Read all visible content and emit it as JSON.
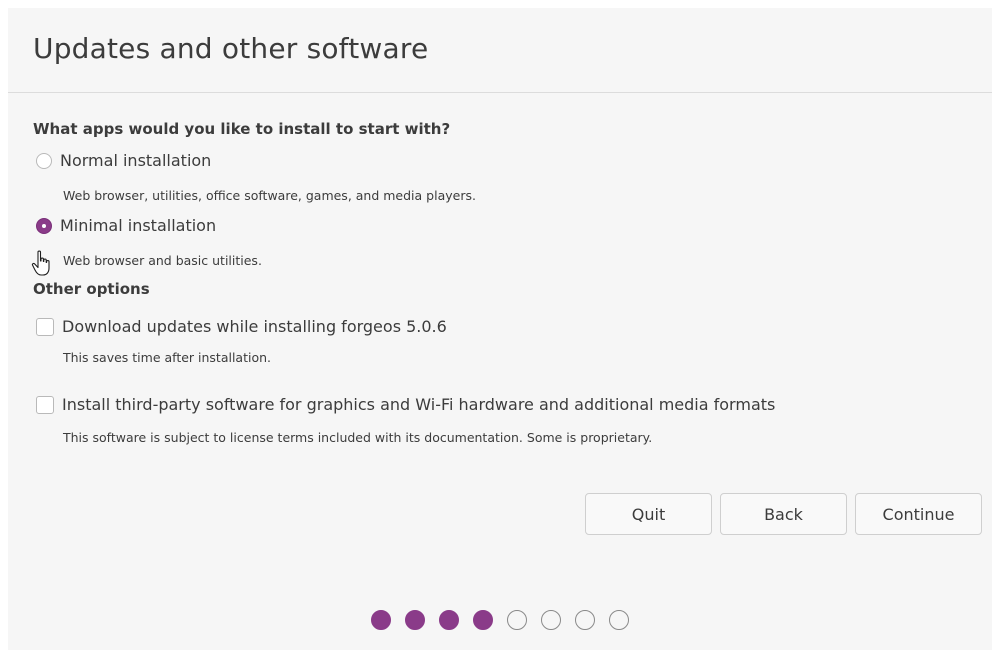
{
  "page": {
    "title": "Updates and other software"
  },
  "apps_section": {
    "heading": "What apps would you like to install to start with?",
    "options": [
      {
        "label": "Normal installation",
        "description": "Web browser, utilities, office software, games, and media players.",
        "selected": false
      },
      {
        "label": "Minimal installation",
        "description": "Web browser and basic utilities.",
        "selected": true
      }
    ]
  },
  "other_section": {
    "heading": "Other options",
    "options": [
      {
        "label": "Download updates while installing forgeos 5.0.6",
        "description": "This saves time after installation.",
        "checked": false
      },
      {
        "label": "Install third-party software for graphics and Wi-Fi hardware and additional media formats",
        "description": "This software is subject to license terms included with its documentation. Some is proprietary.",
        "checked": false
      }
    ]
  },
  "buttons": {
    "quit": "Quit",
    "back": "Back",
    "continue": "Continue"
  },
  "progress": {
    "total_steps": 8,
    "completed_steps": 4
  },
  "colors": {
    "accent": "#8a3b89",
    "window_bg": "#f6f6f6",
    "text": "#3c3c3c"
  }
}
